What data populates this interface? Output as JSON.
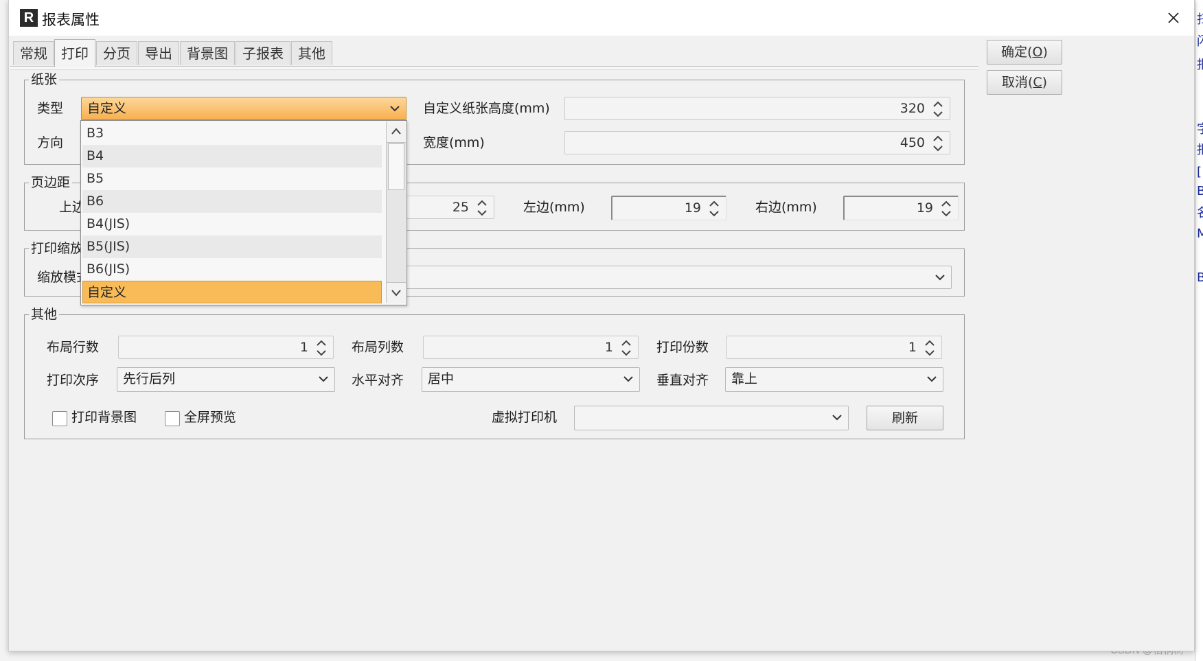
{
  "dialog": {
    "title": "报表属性",
    "app_icon_letter": "R",
    "close_glyph": "✕"
  },
  "tabs": [
    {
      "label": "常规",
      "active": false
    },
    {
      "label": "打印",
      "active": true
    },
    {
      "label": "分页",
      "active": false
    },
    {
      "label": "导出",
      "active": false
    },
    {
      "label": "背景图",
      "active": false
    },
    {
      "label": "子报表",
      "active": false
    },
    {
      "label": "其他",
      "active": false
    }
  ],
  "buttons": {
    "ok_label": "确定(",
    "ok_key": "O",
    "ok_tail": ")",
    "cancel_label": "取消(",
    "cancel_key": "C",
    "cancel_tail": ")"
  },
  "paper": {
    "title": "纸张",
    "type_label": "类型",
    "type_value": "自定义",
    "direction_label": "方向",
    "height_label": "自定义纸张高度(mm)",
    "height_value": "320",
    "width_label": "宽度(mm)",
    "width_value": "450",
    "options": [
      "B3",
      "B4",
      "B5",
      "B6",
      "B4(JIS)",
      "B5(JIS)",
      "B6(JIS)",
      "自定义"
    ],
    "selected_option": "自定义"
  },
  "margins": {
    "title": "页边距",
    "top_label": "上边",
    "top_value": "25",
    "left_label": "左边(mm)",
    "left_value": "19",
    "right_label": "右边(mm)",
    "right_value": "19"
  },
  "scale": {
    "title": "打印缩放",
    "mode_label": "缩放模式",
    "mode_value": ""
  },
  "other": {
    "title": "其他",
    "rows_label": "布局行数",
    "rows_value": "1",
    "cols_label": "布局列数",
    "cols_value": "1",
    "copies_label": "打印份数",
    "copies_value": "1",
    "order_label": "打印次序",
    "order_value": "先行后列",
    "halign_label": "水平对齐",
    "halign_value": "居中",
    "valign_label": "垂直对齐",
    "valign_value": "靠上",
    "print_bg_label": "打印背景图",
    "print_bg_checked": false,
    "fullscreen_label": "全屏预览",
    "fullscreen_checked": false,
    "virtual_printer_label": "虚拟打印机",
    "virtual_printer_value": "",
    "refresh_label": "刷新"
  },
  "watermark": "CSDN @梧桐树",
  "background_chars": [
    "扫",
    "闪",
    "报",
    "字",
    "报",
    "[",
    "B",
    "名",
    "ML",
    "B"
  ],
  "colors": {
    "selection_orange": "#f8bb57",
    "title_bar": "#ffffff",
    "dialog_bg": "#f1f1f1"
  }
}
